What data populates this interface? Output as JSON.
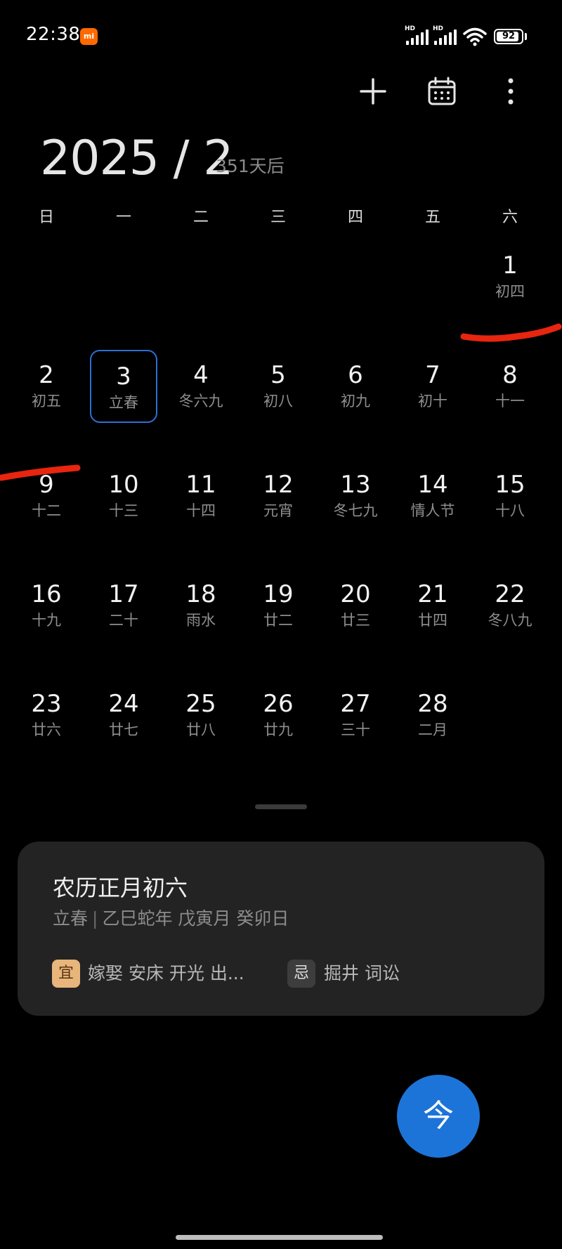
{
  "status_bar": {
    "time": "22:38",
    "brand_badge": "mi",
    "signal_1_label": "HD",
    "signal_2_label": "HD",
    "battery": "92",
    "battery_level_percent": 92
  },
  "toolbar": {
    "add_icon": "plus-icon",
    "calendar_icon": "calendar-icon",
    "more_icon": "more-vertical-icon"
  },
  "header": {
    "year_month": "2025 / 2",
    "days_after": "351天后"
  },
  "weekdays": [
    "日",
    "一",
    "二",
    "三",
    "四",
    "五",
    "六"
  ],
  "days": [
    {
      "num": "1",
      "sub": "初四"
    },
    {
      "num": "2",
      "sub": "初五"
    },
    {
      "num": "3",
      "sub": "立春"
    },
    {
      "num": "4",
      "sub": "冬六九"
    },
    {
      "num": "5",
      "sub": "初八"
    },
    {
      "num": "6",
      "sub": "初九"
    },
    {
      "num": "7",
      "sub": "初十"
    },
    {
      "num": "8",
      "sub": "十一"
    },
    {
      "num": "9",
      "sub": "十二"
    },
    {
      "num": "10",
      "sub": "十三"
    },
    {
      "num": "11",
      "sub": "十四"
    },
    {
      "num": "12",
      "sub": "元宵"
    },
    {
      "num": "13",
      "sub": "冬七九"
    },
    {
      "num": "14",
      "sub": "情人节"
    },
    {
      "num": "15",
      "sub": "十八"
    },
    {
      "num": "16",
      "sub": "十九"
    },
    {
      "num": "17",
      "sub": "二十"
    },
    {
      "num": "18",
      "sub": "雨水"
    },
    {
      "num": "19",
      "sub": "廿二"
    },
    {
      "num": "20",
      "sub": "廿三"
    },
    {
      "num": "21",
      "sub": "廿四"
    },
    {
      "num": "22",
      "sub": "冬八九"
    },
    {
      "num": "23",
      "sub": "廿六"
    },
    {
      "num": "24",
      "sub": "廿七"
    },
    {
      "num": "25",
      "sub": "廿八"
    },
    {
      "num": "26",
      "sub": "廿九"
    },
    {
      "num": "27",
      "sub": "三十"
    },
    {
      "num": "28",
      "sub": "二月"
    }
  ],
  "lunar_card": {
    "title": "农历正月初六",
    "solar_term": "立春",
    "separator": "|",
    "ganzhi": "乙巳蛇年 戊寅月 癸卯日",
    "yi_label": "宜",
    "yi_items": "嫁娶 安床 开光 出...",
    "ji_label": "忌",
    "ji_items": "掘井 词讼"
  },
  "today_button": {
    "label": "今"
  },
  "colors": {
    "background": "#000000",
    "selected_border": "#2f6fd6",
    "card_background": "#232323",
    "yi_badge": "#e8b57c",
    "ji_badge": "#3d3d3d",
    "fab": "#1d74d8",
    "annotation_mark": "#e8250f"
  }
}
